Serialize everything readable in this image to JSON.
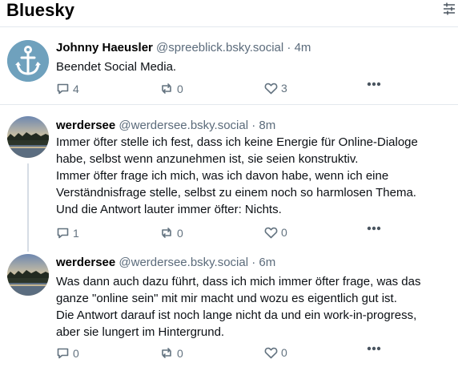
{
  "app": {
    "title": "Bluesky"
  },
  "posts": [
    {
      "author": "Johnny Haeusler",
      "handle": "@spreeblick.bsky.social",
      "sep": "·",
      "time": "4m",
      "text": "Beendet Social Media.",
      "replies": "4",
      "reposts": "0",
      "likes": "3",
      "avatar": "anchor",
      "avatar_bg": "#6fa1bd"
    },
    {
      "author": "werdersee",
      "handle": "@werdersee.bsky.social",
      "sep": "·",
      "time": "8m",
      "text": "Immer öfter stelle ich fest, dass ich keine Energie für Online-Dialoge\nhabe, selbst wenn anzunehmen ist, sie seien konstruktiv.\nImmer öfter frage ich mich, was ich davon habe, wenn ich eine\nVerständnisfrage stelle, selbst zu einem noch so harmlosen Thema.\nUnd die Antwort lauter immer öfter: Nichts.",
      "replies": "1",
      "reposts": "0",
      "likes": "0",
      "avatar": "lake-sunset"
    },
    {
      "author": "werdersee",
      "handle": "@werdersee.bsky.social",
      "sep": "·",
      "time": "6m",
      "text": "Was dann auch dazu führt, dass ich mich immer öfter frage, was das\nganze \"online sein\" mit mir macht und wozu es eigentlich gut ist.\nDie Antwort darauf ist noch lange nicht da und ein work-in-progress,\naber sie lungert im Hintergrund.",
      "replies": "0",
      "reposts": "0",
      "likes": "0",
      "avatar": "lake-sunset"
    }
  ],
  "icons": {
    "reply": "reply-bubble-icon",
    "repost": "repost-arrows-icon",
    "like": "heart-icon",
    "more": "more-dots-icon",
    "filter": "filter-sliders-icon"
  },
  "colors": {
    "accent_blue": "#1083fe",
    "muted": "#62727f",
    "divider": "#e3e8ee"
  }
}
